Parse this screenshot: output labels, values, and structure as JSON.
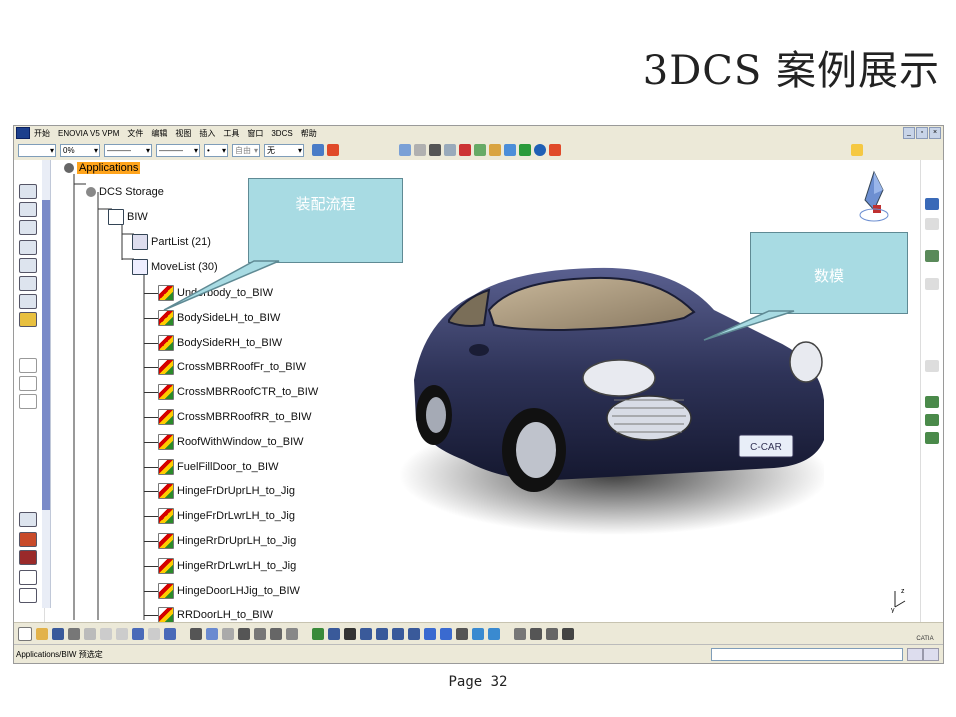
{
  "slide": {
    "title": "3DCS 案例展示",
    "page": "Page 32"
  },
  "app": {
    "menu": [
      "开始",
      "ENOVIA V5 VPM",
      "文件",
      "编辑",
      "视图",
      "插入",
      "工具",
      "窗口",
      "3DCS",
      "帮助"
    ],
    "toolbar": {
      "line_type": "",
      "percent": "0%",
      "line_style_1": "———",
      "line_style_2": "———",
      "dot": "•",
      "layer": "自由",
      "filter": "无"
    },
    "status_text": "Applications/BIW 预选定"
  },
  "tree": {
    "root": "Applications",
    "storage": "DCS Storage",
    "product": "BIW",
    "partlist": "PartList (21)",
    "movelist": "MoveList (30)",
    "moves": [
      "Underbody_to_BIW",
      "BodySideLH_to_BIW",
      "BodySideRH_to_BIW",
      "CrossMBRRoofFr_to_BIW",
      "CrossMBRRoofCTR_to_BIW",
      "CrossMBRRoofRR_to_BIW",
      "RoofWithWindow_to_BIW",
      "FuelFillDoor_to_BIW",
      "HingeFrDrUprLH_to_Jig",
      "HingeFrDrLwrLH_to_Jig",
      "HingeRrDrUprLH_to_Jig",
      "HingeRrDrLwrLH_to_Jig",
      "HingeDoorLHJig_to_BIW",
      "RRDoorLH_to_BIW"
    ]
  },
  "callouts": {
    "assembly_flow": "装配流程",
    "digital_model": "数模"
  },
  "car": {
    "plate_text": "C-CAR",
    "body_color": "#2e3358"
  },
  "logo": {
    "brand": "CATIA"
  },
  "axis": {
    "label": "xyz"
  }
}
